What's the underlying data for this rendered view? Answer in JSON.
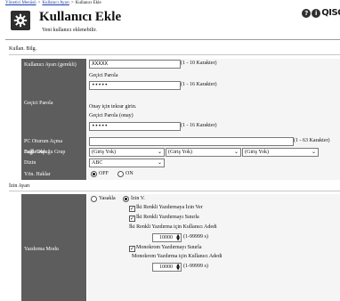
{
  "breadcrumb": {
    "items": [
      "Yönetici Menüsü",
      "Kullanıcı Ayarı",
      "Kullanıcı Ekle"
    ],
    "separator": ">"
  },
  "header": {
    "title": "Kullanıcı Ekle",
    "subtitle": "Yeni kullanıcı eklenebilir.",
    "brand": "QISC"
  },
  "sections": {
    "user_info": "Kullan. Bilg.",
    "permissions": "İzin Ayarı"
  },
  "form": {
    "username": {
      "label": "Kullanıcı Ayarı (gerekli)",
      "value": "XXXXX",
      "hint": "(1 - 10 Karakter)"
    },
    "temp_password": {
      "label": "Geçici Parola",
      "sublabel": "Geçici Parola",
      "value": "•••••",
      "hint": "(1 - 16 Karakter)",
      "confirm_prompt": "Onay için tekrar girin.",
      "confirm_label": "Geçici Parola (onay)",
      "confirm_value": "•••••",
      "confirm_hint": "(1 - 16 Karakter)"
    },
    "pc_login": {
      "label": "PC Oturum Açma",
      "value": "",
      "hint": "(1 - 63 Karakter)"
    },
    "group": {
      "label": "Bağlı Olduğu Grup",
      "overlap": "Bağlı Grup",
      "options": [
        "(Giriş Yok)",
        "(Giriş Yok)",
        "(Giriş Yok)"
      ]
    },
    "index": {
      "label": "Dizin",
      "value": "ABC"
    },
    "admin_rights": {
      "label": "Yön. Haklar",
      "off": "OFF",
      "on": "ON"
    }
  },
  "print_mode": {
    "label": "Yazdırma Modu",
    "prohibit": "Yasakla",
    "permit": "İzin V.",
    "allow_color": "İki Renkli Yazdırmaya İzin Ver",
    "limit_color": "İki Renkli Yazdırmayı Sınırla",
    "color_count_label": "İki Renkli Yazdırma için Kullanıcı Adedi",
    "color_count_value": "10000",
    "color_count_range": "(1-99999 s)",
    "limit_mono": "Monokrom Yazdırmayı Sınırla",
    "mono_count_label": "Monokrom Yazdırma için Kullanıcı Adedi",
    "mono_count_value": "10000",
    "mono_count_range": "(1-99999 s)"
  },
  "icons": {
    "title": "gear-icon",
    "help": "help-icon",
    "info": "info-icon",
    "spinner": "spinner-arrows-icon",
    "dropdown": "chevron-down-icon"
  },
  "colors": {
    "label_bg": "#5d5d5d",
    "value_bg": "#f5f5f5",
    "link": "#1a3ea8"
  }
}
